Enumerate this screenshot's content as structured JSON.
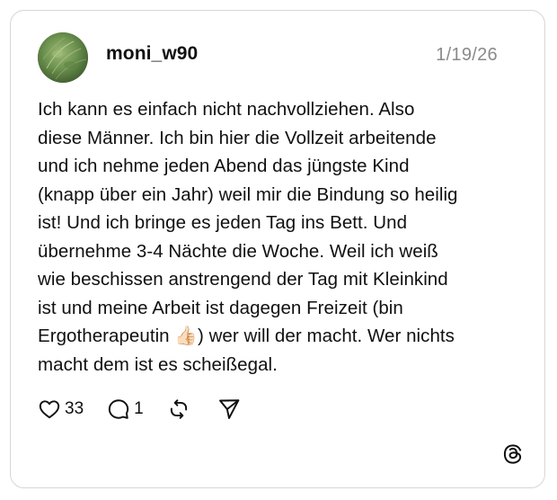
{
  "post": {
    "username": "moni_w90",
    "date": "1/19/26",
    "text": "Ich kann es einfach nicht nachvollziehen. Also\ndiese Männer. Ich bin hier die Vollzeit arbeitende\nund ich nehme jeden Abend das jüngste Kind\n(knapp über ein Jahr) weil mir die Bindung so heilig\nist! Und ich bringe es jeden Tag ins Bett. Und\nübernehme 3-4 Nächte die Woche. Weil ich weiß\nwie beschissen anstrengend der Tag mit Kleinkind\nist und meine Arbeit ist dagegen Freizeit (bin\nErgotherapeutin 👍🏻) wer will der macht. Wer nichts\nmacht dem ist es scheißegal."
  },
  "actions": {
    "like_count": "33",
    "reply_count": "1"
  },
  "icons": {
    "like": "heart-icon",
    "reply": "comment-bubble-icon",
    "repost": "repost-icon",
    "share": "send-icon",
    "brand": "threads-logo-icon"
  },
  "colors": {
    "text": "#101010",
    "muted": "#8a8a8a",
    "border": "#d6d6d6"
  }
}
